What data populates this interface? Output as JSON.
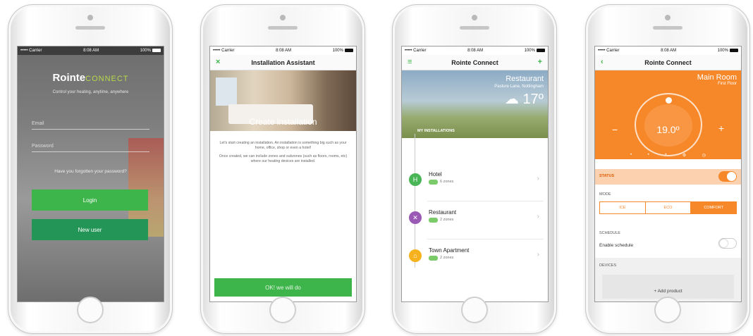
{
  "status_bar": {
    "carrier": "••••• Carrier",
    "time": "8:08 AM",
    "battery": "100%"
  },
  "login": {
    "brand_main": "Rointe",
    "brand_sub": "CONNECT",
    "tagline": "Control your heating, anytime, anywhere",
    "email_placeholder": "Email",
    "password_placeholder": "Password",
    "forgot": "Have you forgotten your password?",
    "login_label": "Login",
    "new_user_label": "New user"
  },
  "assistant": {
    "title": "Installation Assistant",
    "close_icon": "×",
    "hero_label": "Create installation",
    "para1": "Let's start creating an installation. An installation is something big such as your home, office, shop or even a hotel!",
    "para2": "Once created, we can include zones and subzones (such as floors, rooms, etc) where our heating devices are installed.",
    "ok_label": "OK! we will do"
  },
  "connect": {
    "title": "Rointe Connect",
    "menu_icon": "≡",
    "add_icon": "+",
    "weather_name": "Restaurant",
    "weather_location": "Pasture Lane, Nottingham",
    "weather_temp": "17º",
    "my_installations": "MY INSTALLATIONS",
    "installations": [
      {
        "name": "Hotel",
        "zones": "6 zones",
        "color": "#48b556",
        "icon": "H"
      },
      {
        "name": "Restaurant",
        "zones": "2 zones",
        "color": "#9b59b6",
        "icon": "✕"
      },
      {
        "name": "Town Apartment",
        "zones": "2 zones",
        "color": "#f5b21e",
        "icon": "⌂"
      }
    ]
  },
  "room": {
    "title": "Rointe Connect",
    "back_icon": "‹",
    "room_name": "Main Room",
    "floor": "First Floor",
    "temperature": "19.0º",
    "minus": "−",
    "plus": "+",
    "status_label": "STATUS",
    "mode_label": "MODE",
    "modes": [
      "ICE",
      "ECO",
      "COMFORT"
    ],
    "schedule_label": "SCHEDULE",
    "enable_schedule": "Enable schedule",
    "devices_label": "DEVICES",
    "add_product": "+ Add product"
  }
}
